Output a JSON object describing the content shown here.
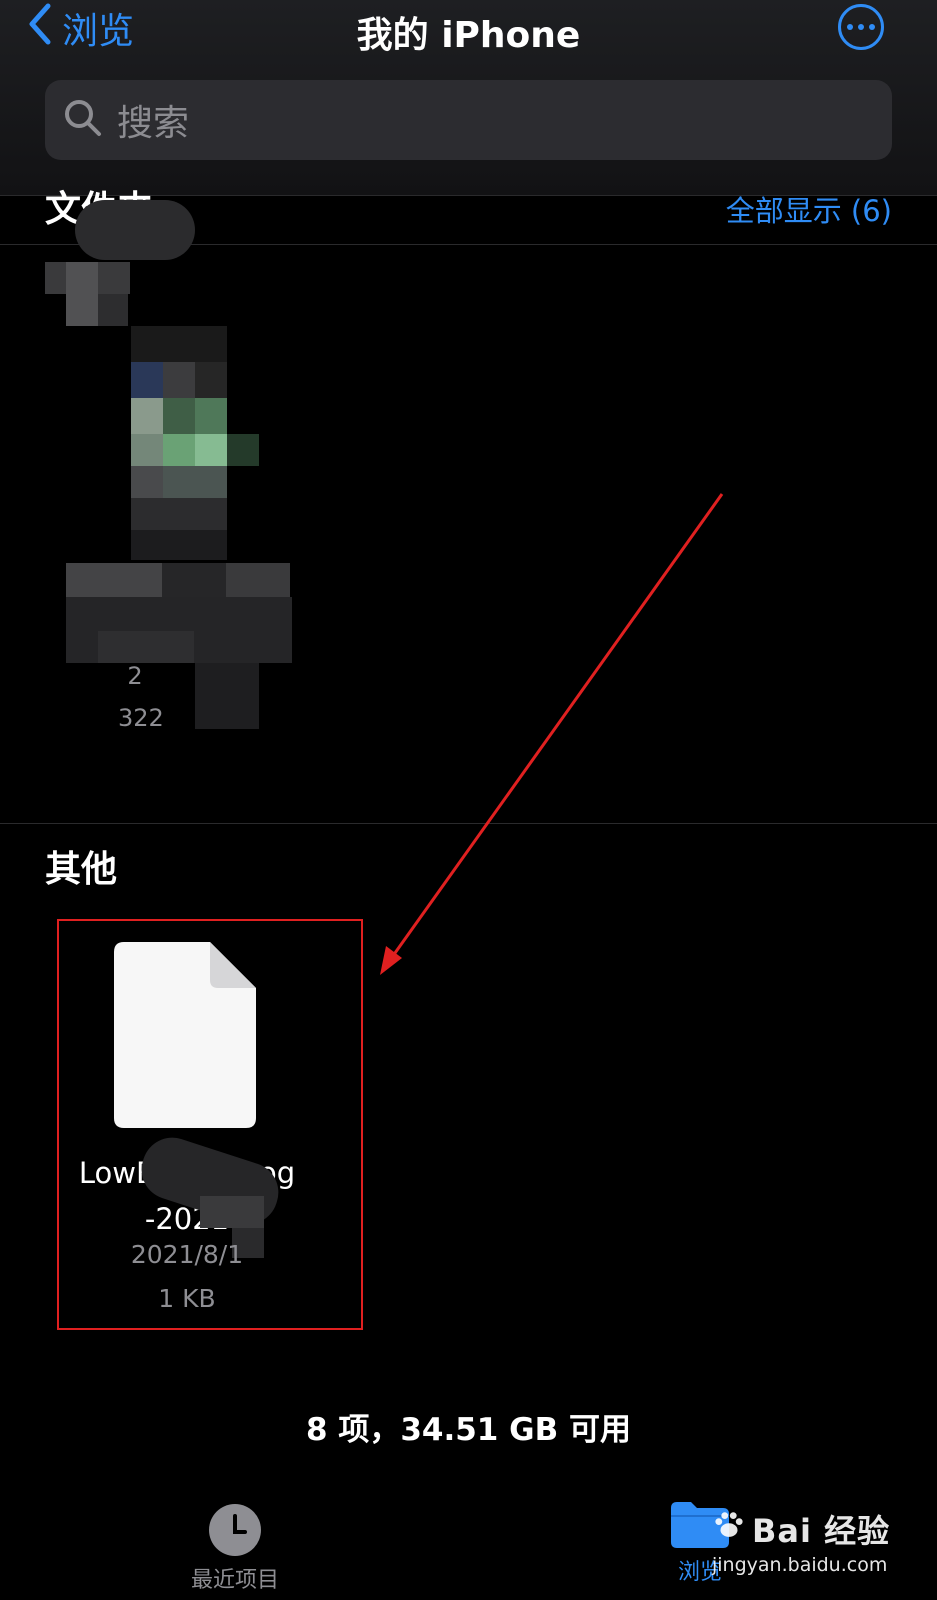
{
  "nav": {
    "back_label": "浏览",
    "title": "我的 iPhone"
  },
  "search": {
    "placeholder": "搜索"
  },
  "shared_section": {
    "title_partial": "文件夹",
    "show_all_label": "全部显示 (6)"
  },
  "shared_item": {
    "date_partial": "2",
    "size_partial": "322"
  },
  "other_section": {
    "title": "其他"
  },
  "file_item": {
    "name_line1": "LowBatteryLog",
    "name_line2": "-2021",
    "date": "2021/8/1",
    "size": "1 KB"
  },
  "footer": {
    "status": "8 项，34.51 GB 可用"
  },
  "tabbar": {
    "recent_label": "最近项目",
    "browse_label": "浏览"
  },
  "watermark": {
    "brand": "Bai 经验",
    "url": "jingyan.baidu.com"
  },
  "colors": {
    "accent": "#2f8cf5",
    "annotation": "#e02020",
    "background": "#000000"
  },
  "icons": [
    "back-chevron-icon",
    "more-ellipsis-icon",
    "search-icon",
    "document-icon",
    "clock-icon",
    "folder-icon",
    "paw-icon"
  ]
}
